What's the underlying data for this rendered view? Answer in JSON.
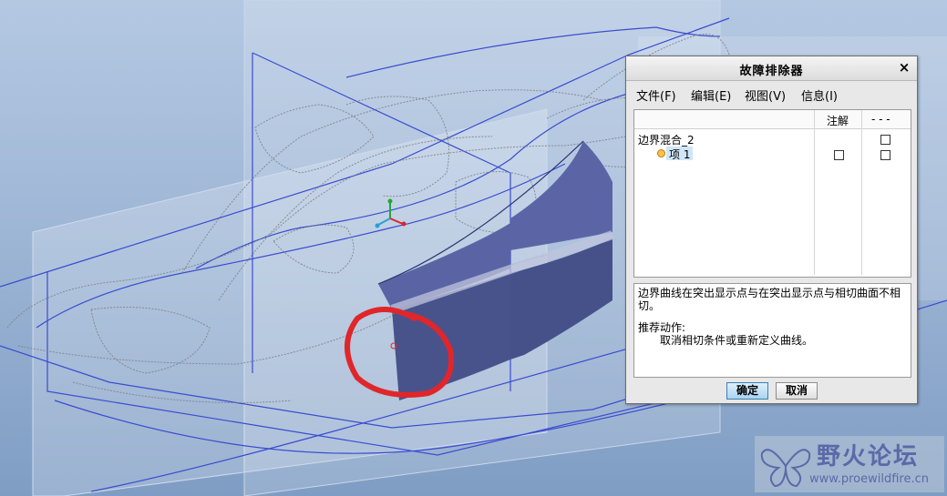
{
  "dialog": {
    "title": "故障排除器",
    "close_symbol": "×",
    "menu": [
      "文件(F)",
      "编辑(E)",
      "视图(V)",
      "信息(I)"
    ],
    "tree": {
      "columns": [
        "注解",
        "- - -"
      ],
      "rows": [
        {
          "label": "边界混合_2",
          "annotation_checkbox": null,
          "other_checked": false
        },
        {
          "label": "项 1",
          "annotation_checked": false,
          "other_checked": false,
          "selected": true
        }
      ]
    },
    "message": {
      "text": "边界曲线在突出显示点与在突出显示点与相切曲面不相切。",
      "action_heading": "推荐动作:",
      "action_text": "取消相切条件或重新定义曲线。"
    },
    "buttons": {
      "ok": "确定",
      "cancel": "取消"
    }
  },
  "watermark": {
    "title": "野火论坛",
    "url": "www.proewildfire.cn"
  },
  "colors": {
    "surface": "#4b5690",
    "sketch_lines": "#3a4cd0",
    "annotation_circle": "#e0262a"
  }
}
